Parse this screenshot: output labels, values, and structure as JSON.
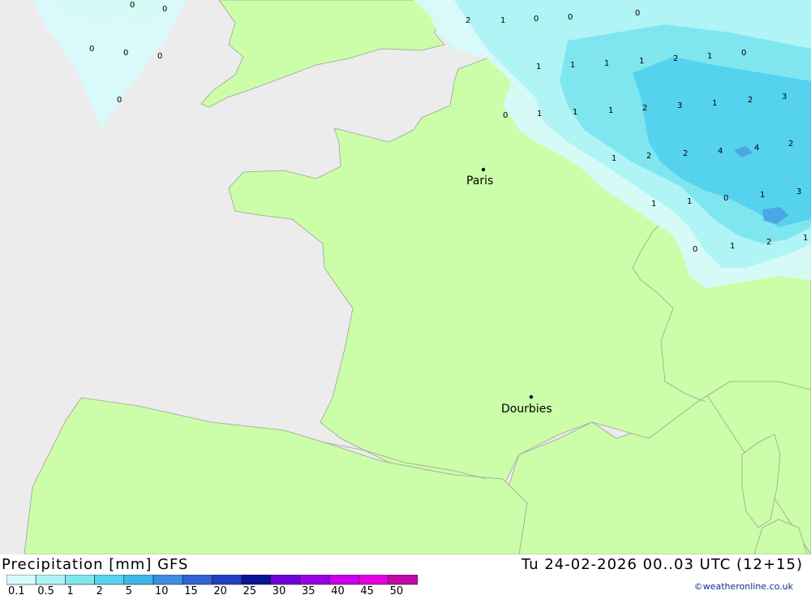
{
  "colors": {
    "sea": "#ececec",
    "land": "#ccfda8",
    "border": "#9aa39a",
    "precip_0": "#d7fafc",
    "precip_1": "#aef3f6",
    "precip_2": "#7fe6f0",
    "precip_5": "#55d3ee",
    "precip_10": "#4a9ee0"
  },
  "map": {
    "cities": [
      {
        "name": "Paris"
      },
      {
        "name": "Dourbies"
      }
    ],
    "values": [
      "0",
      "0",
      "0",
      "0",
      "0",
      "0",
      "2",
      "1",
      "0",
      "0",
      "0",
      "1",
      "1",
      "1",
      "1",
      "2",
      "1",
      "0",
      "0",
      "1",
      "1",
      "1",
      "2",
      "3",
      "1",
      "2",
      "3",
      "1",
      "2",
      "2",
      "4",
      "4",
      "2",
      "1",
      "1",
      "0",
      "1",
      "3",
      "0",
      "1",
      "2",
      "1"
    ]
  },
  "footer": {
    "title": "Precipitation [mm] GFS",
    "date": "Tu 24-02-2026 00..03 UTC (12+15)",
    "credit": "©weatheronline.co.uk"
  },
  "legend": {
    "labels": [
      "0.1",
      "0.5",
      "1",
      "2",
      "5",
      "10",
      "15",
      "20",
      "25",
      "30",
      "35",
      "40",
      "45",
      "50"
    ],
    "colors": [
      "#d7fafc",
      "#aef3f6",
      "#7fe6f0",
      "#55d3ee",
      "#3fb7ea",
      "#3d8de0",
      "#2f63d4",
      "#213fc2",
      "#0a1296",
      "#7000d8",
      "#9a00e6",
      "#c800ec",
      "#e200e0",
      "#c10aa8"
    ]
  }
}
